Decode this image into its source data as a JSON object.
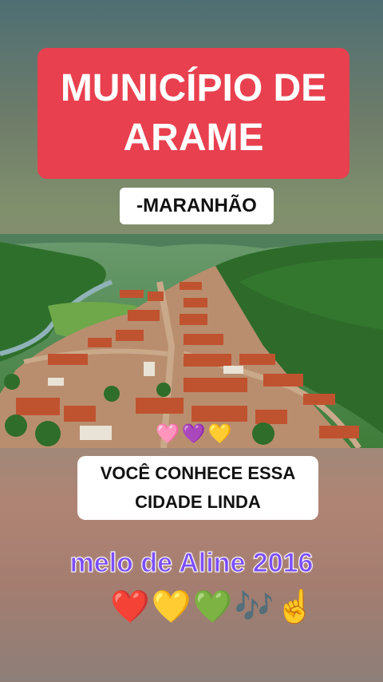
{
  "title": {
    "line1": "MUNICÍPIO DE",
    "line2": "ARAME",
    "background": "#e8404f"
  },
  "subtitle": "-MARANHÃO",
  "photo": {
    "subject": "aerial-view-town"
  },
  "decor_hearts": [
    "🩷",
    "💜",
    "💛"
  ],
  "question": {
    "line1": "VOCÊ CONHECE ESSA",
    "line2": "CIDADE LINDA"
  },
  "music": {
    "text": "melo de Aline 2016",
    "color": "#7c4dff"
  },
  "emoji_row": [
    "❤️",
    "💛",
    "💚",
    "🎶",
    "☝️"
  ]
}
